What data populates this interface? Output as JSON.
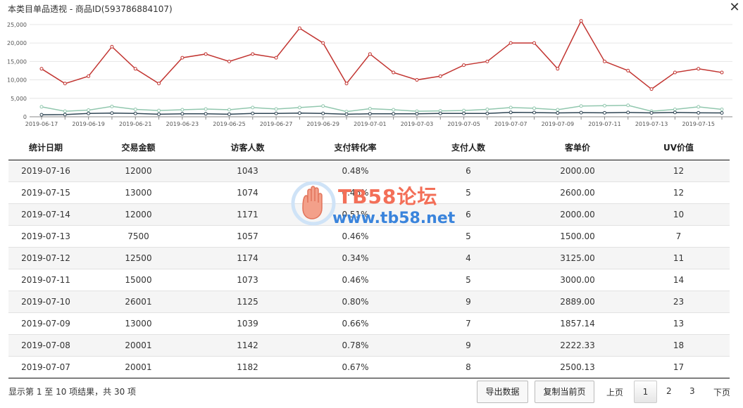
{
  "window": {
    "title": "本类目单品透视 - 商品ID(593786884107)",
    "close_label": "✕"
  },
  "chart_data": {
    "type": "line",
    "x": [
      "2019-06-17",
      "2019-06-18",
      "2019-06-19",
      "2019-06-20",
      "2019-06-21",
      "2019-06-22",
      "2019-06-23",
      "2019-06-24",
      "2019-06-25",
      "2019-06-26",
      "2019-06-27",
      "2019-06-28",
      "2019-06-29",
      "2019-06-30",
      "2019-07-01",
      "2019-07-02",
      "2019-07-03",
      "2019-07-04",
      "2019-07-05",
      "2019-07-06",
      "2019-07-07",
      "2019-07-08",
      "2019-07-09",
      "2019-07-10",
      "2019-07-11",
      "2019-07-12",
      "2019-07-13",
      "2019-07-14",
      "2019-07-15",
      "2019-07-16"
    ],
    "x_tick_labels": [
      "2019-06-17",
      "2019-06-19",
      "2019-06-21",
      "2019-06-23",
      "2019-06-25",
      "2019-06-27",
      "2019-06-29",
      "2019-07-01",
      "2019-07-03",
      "2019-07-05",
      "2019-07-07",
      "2019-07-09",
      "2019-07-11",
      "2019-07-13",
      "2019-07-15"
    ],
    "y_ticks": [
      0,
      5000,
      10000,
      15000,
      20000,
      25000
    ],
    "y_tick_labels": [
      "0",
      "5,000",
      "10,000",
      "15,000",
      "20,000",
      "25,000"
    ],
    "ylim": [
      0,
      26500
    ],
    "grid": "horizontal",
    "series": [
      {
        "color": "#c23531",
        "values": [
          13000,
          9000,
          11000,
          19000,
          13000,
          9000,
          16000,
          17000,
          15000,
          17000,
          16000,
          24000,
          20000,
          9000,
          17000,
          12000,
          10000,
          11000,
          14000,
          15000,
          20001,
          20001,
          13000,
          26001,
          15000,
          12500,
          7500,
          12000,
          13000,
          12000
        ]
      },
      {
        "color": "#91c7ae",
        "values": [
          2700,
          1500,
          1800,
          2800,
          2000,
          1700,
          1900,
          2100,
          1900,
          2500,
          2100,
          2500,
          2900,
          1400,
          2200,
          1900,
          1500,
          1600,
          1700,
          2000,
          2500,
          2300,
          1900,
          2900,
          3000,
          3100,
          1500,
          2000,
          2700,
          2000
        ]
      },
      {
        "color": "#2f4554",
        "values": [
          550,
          600,
          900,
          1000,
          900,
          700,
          800,
          800,
          700,
          900,
          900,
          1000,
          900,
          700,
          800,
          800,
          800,
          900,
          900,
          900,
          1182,
          1142,
          1039,
          1125,
          1073,
          1174,
          1057,
          1171,
          1074,
          1043
        ]
      }
    ]
  },
  "table": {
    "headers": [
      "统计日期",
      "交易金额",
      "访客人数",
      "支付转化率",
      "支付人数",
      "客单价",
      "UV价值"
    ],
    "rows": [
      [
        "2019-07-16",
        "12000",
        "1043",
        "0.48%",
        "6",
        "2000.00",
        "12"
      ],
      [
        "2019-07-15",
        "13000",
        "1074",
        "0.46%",
        "5",
        "2600.00",
        "12"
      ],
      [
        "2019-07-14",
        "12000",
        "1171",
        "0.51%",
        "6",
        "2000.00",
        "10"
      ],
      [
        "2019-07-13",
        "7500",
        "1057",
        "0.46%",
        "5",
        "1500.00",
        "7"
      ],
      [
        "2019-07-12",
        "12500",
        "1174",
        "0.34%",
        "4",
        "3125.00",
        "11"
      ],
      [
        "2019-07-11",
        "15000",
        "1073",
        "0.46%",
        "5",
        "3000.00",
        "14"
      ],
      [
        "2019-07-10",
        "26001",
        "1125",
        "0.80%",
        "9",
        "2889.00",
        "23"
      ],
      [
        "2019-07-09",
        "13000",
        "1039",
        "0.66%",
        "7",
        "1857.14",
        "13"
      ],
      [
        "2019-07-08",
        "20001",
        "1142",
        "0.78%",
        "9",
        "2222.33",
        "18"
      ],
      [
        "2019-07-07",
        "20001",
        "1182",
        "0.67%",
        "8",
        "2500.13",
        "17"
      ]
    ]
  },
  "watermark": {
    "brand": "TB58论坛",
    "url": "www.tb58.net",
    "logo_icon": "hand-icon"
  },
  "footer": {
    "info": "显示第 1 至 10 项结果，共 30 项",
    "export_label": "导出数据",
    "copy_label": "复制当前页",
    "prev_label": "上页",
    "next_label": "下页",
    "pages": [
      "1",
      "2",
      "3"
    ]
  }
}
